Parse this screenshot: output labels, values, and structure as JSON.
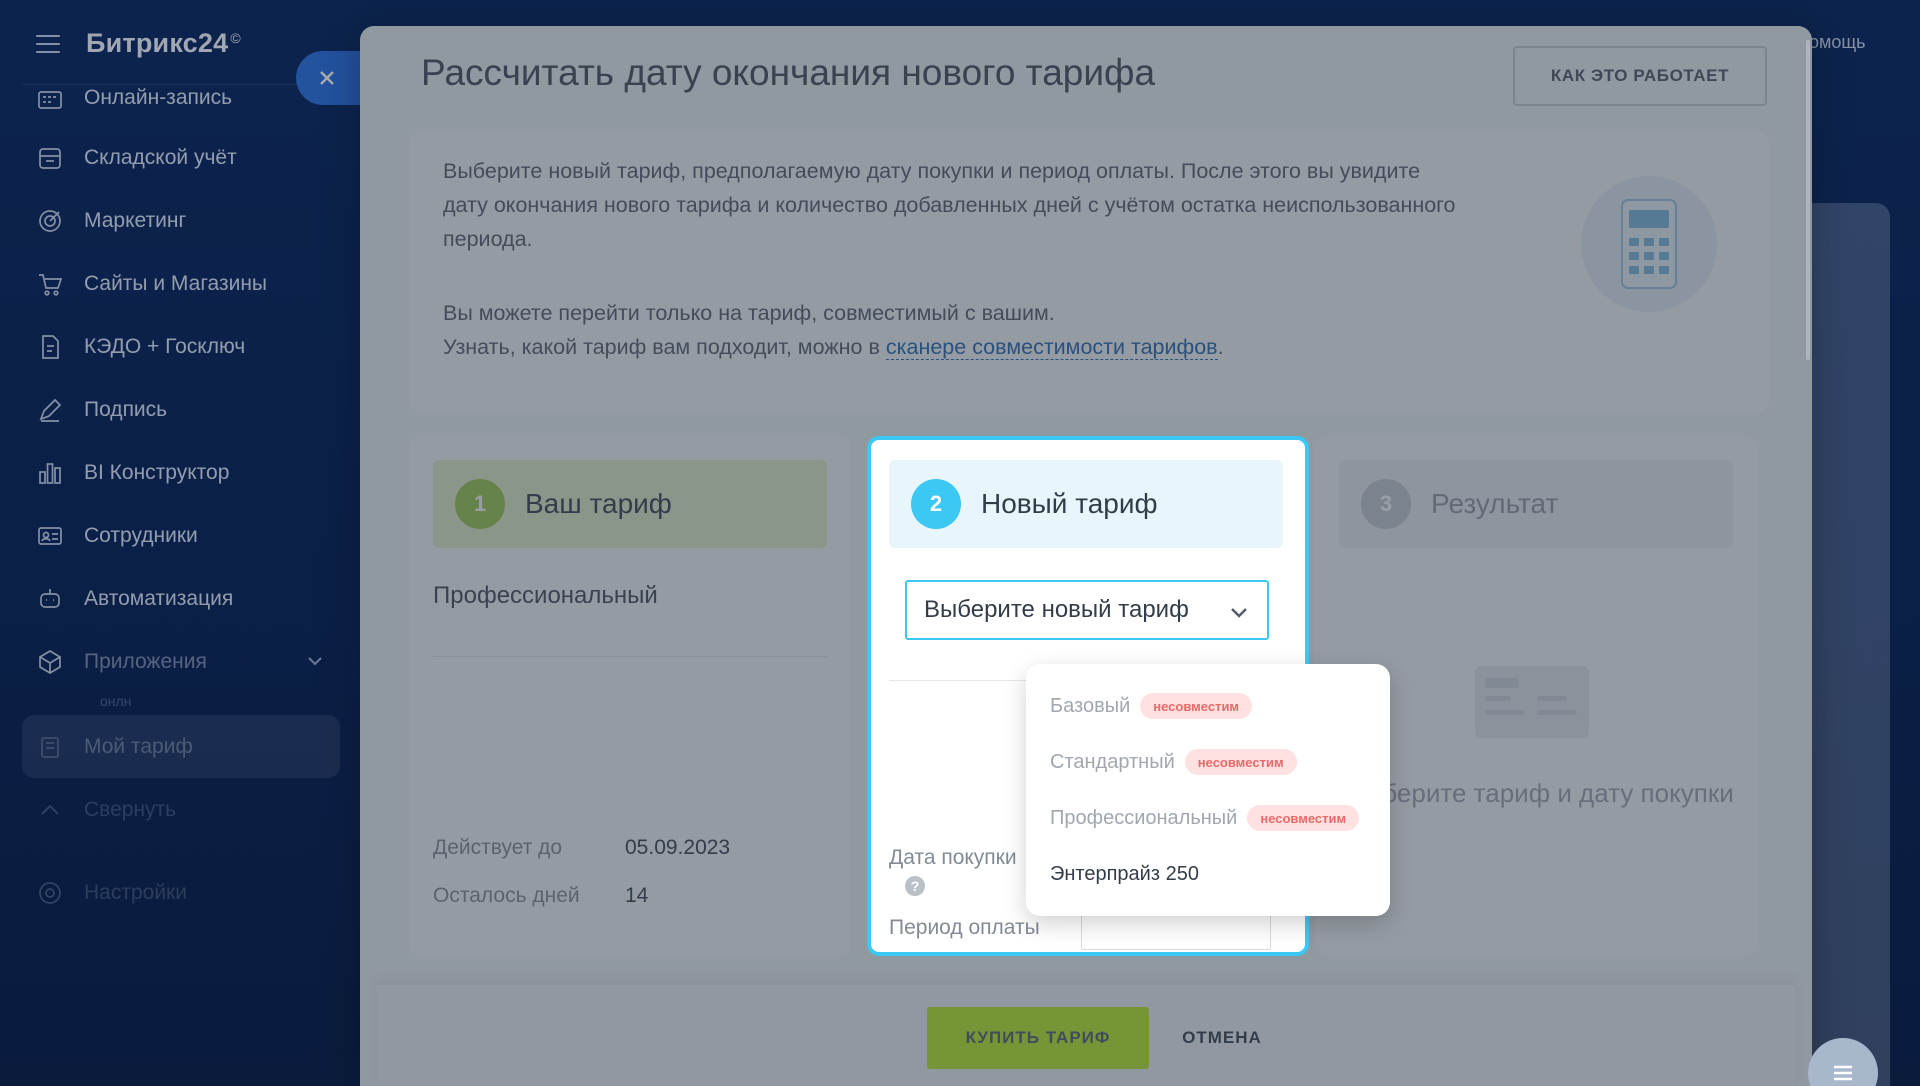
{
  "sidebar": {
    "brand": "Битрикс24",
    "brand_mark": "©",
    "items": [
      {
        "label": "Онлайн-запись",
        "icon": "calendar-grid-icon"
      },
      {
        "label": "Складской учёт",
        "icon": "warehouse-icon"
      },
      {
        "label": "Маркетинг",
        "icon": "target-icon"
      },
      {
        "label": "Сайты и Магазины",
        "icon": "cart-icon"
      },
      {
        "label": "КЭДО + Госключ",
        "icon": "document-icon"
      },
      {
        "label": "Подпись",
        "icon": "pen-icon"
      },
      {
        "label": "BI Конструктор",
        "icon": "bar-chart-icon"
      },
      {
        "label": "Сотрудники",
        "icon": "id-card-icon"
      },
      {
        "label": "Автоматизация",
        "icon": "robot-icon"
      },
      {
        "label": "Приложения",
        "icon": "cube-icon"
      },
      {
        "label": "Мой тариф",
        "icon": "tariff-icon"
      },
      {
        "label": "Свернуть",
        "icon": "chevron-up-icon"
      },
      {
        "label": "Настройки",
        "icon": "gear-icon"
      }
    ],
    "sub_label": "онлн"
  },
  "topbar": {
    "help": "Помощь"
  },
  "modal": {
    "title": "Рассчитать дату окончания нового тарифа",
    "how_button": "КАК ЭТО РАБОТАЕТ",
    "intro": {
      "p1": "Выберите новый тариф, предполагаемую дату покупки и период оплаты. После этого вы увидите дату окончания нового тарифа и количество добавленных дней с учётом остатка неиспользованного периода.",
      "p2_line1": "Вы можете перейти только на тариф, совместимый с вашим.",
      "p2_line2": "Узнать, какой тариф вам подходит, можно в ",
      "p2_link": "сканере совместимости тарифов",
      "p2_end": "."
    },
    "card1": {
      "step": "1",
      "title": "Ваш тариф",
      "plan": "Профессиональный",
      "valid_label": "Действует до",
      "valid_value": "05.09.2023",
      "days_label": "Осталось дней",
      "days_value": "14"
    },
    "card2": {
      "step": "2",
      "title": "Новый тариф",
      "select_placeholder": "Выберите новый тариф",
      "purchase_date_label": "Дата покупки",
      "period_label": "Период оплаты",
      "help_mark": "?"
    },
    "card3": {
      "step": "3",
      "title": "Результат",
      "hint": "Выберите тариф и дату покупки"
    },
    "footer": {
      "buy": "КУПИТЬ ТАРИФ",
      "cancel": "ОТМЕНА"
    }
  },
  "dropdown": {
    "options": [
      {
        "label": "Базовый",
        "badge": "несовместим"
      },
      {
        "label": "Стандартный",
        "badge": "несовместим"
      },
      {
        "label": "Профессиональный",
        "badge": "несовместим"
      },
      {
        "label": "Энтерпрайз 250"
      }
    ]
  },
  "colors": {
    "accent": "#3bc8f5",
    "brand_blue": "#2f72e0",
    "buy_green": "#bbed21",
    "incompatible_badge_bg": "#ffe1e1",
    "incompatible_badge_text": "#e66a6a",
    "link": "#2067b0"
  }
}
